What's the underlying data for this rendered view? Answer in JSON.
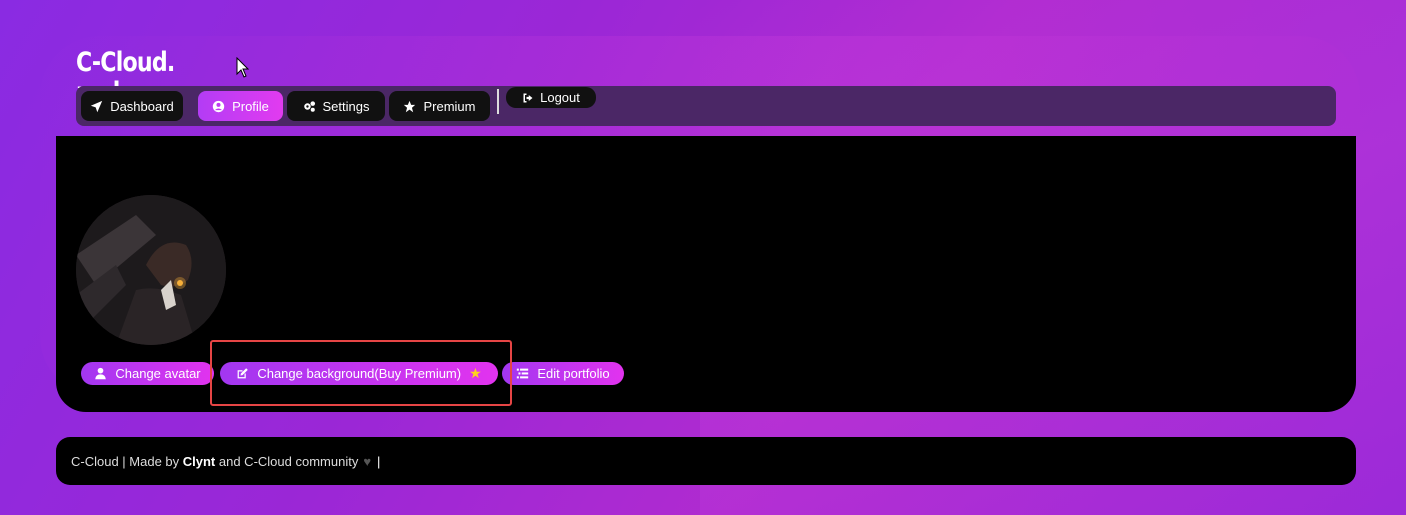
{
  "brand": {
    "name": "C-Cloud.",
    "subtitle": "rocks"
  },
  "nav": {
    "items": [
      {
        "label": "Dashboard",
        "icon": "paper-plane-icon",
        "active": false
      },
      {
        "label": "Profile",
        "icon": "user-circle-icon",
        "active": true
      },
      {
        "label": "Settings",
        "icon": "gears-icon",
        "active": false
      },
      {
        "label": "Premium",
        "icon": "star-icon",
        "active": false
      }
    ],
    "logout_label": "Logout"
  },
  "profile": {
    "actions": {
      "change_avatar": "Change avatar",
      "change_background": "Change background(Buy Premium)",
      "edit_portfolio": "Edit portfolio"
    }
  },
  "footer": {
    "prefix": "C-Cloud | Made by ",
    "author": "Clynt",
    "suffix": " and C-Cloud community",
    "end": "|"
  },
  "colors": {
    "accent_start": "#a237f0",
    "accent_end": "#e233ef",
    "highlight": "#e64545",
    "nav_bg": "#4b2766"
  }
}
